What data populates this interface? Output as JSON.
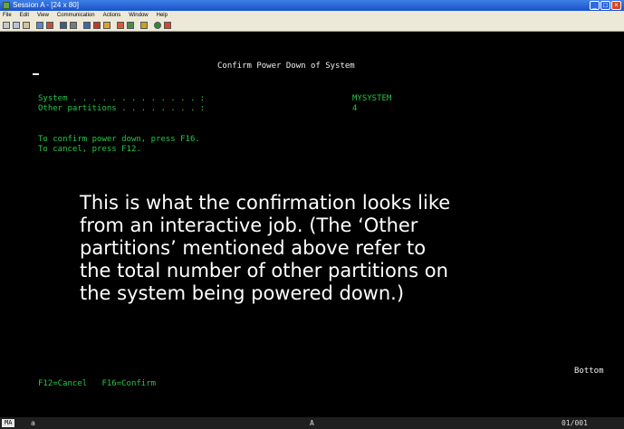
{
  "window": {
    "title": "Session A - [24 x 80]",
    "minimize": "_",
    "maximize": "□",
    "close": "×"
  },
  "menu": {
    "items": [
      "File",
      "Edit",
      "View",
      "Communication",
      "Actions",
      "Window",
      "Help"
    ]
  },
  "toolbar": {
    "icons": [
      "print-icon",
      "copy-icon",
      "paste-icon",
      "send-icon",
      "receive-icon",
      "display-icon",
      "keyboard-icon",
      "record-icon",
      "play-icon",
      "macro-icon",
      "color-icon",
      "settings-icon",
      "help-icon",
      "connect-icon",
      "disconnect-icon"
    ]
  },
  "screen": {
    "heading": "Confirm Power Down of System",
    "fields": [
      {
        "label": "System . . . . . . . . . . . . . :",
        "value": "MYSYSTEM"
      },
      {
        "label": "Other partitions . . . . . . . . :",
        "value": "4"
      }
    ],
    "instructions": [
      "To confirm power down, press F16.",
      "To cancel, press F12."
    ],
    "bottom_marker": "Bottom",
    "function_keys": "F12=Cancel   F16=Confirm"
  },
  "overlay": {
    "lines": [
      "This is what the confirmation looks like",
      "from an interactive job. (The ‘Other",
      "partitions’ mentioned above refer to",
      "the total number of other partitions on",
      "the system being powered down.)"
    ]
  },
  "status": {
    "mode": "MA",
    "indicator": "a",
    "middle": "A",
    "cursor_position": "01/001"
  }
}
